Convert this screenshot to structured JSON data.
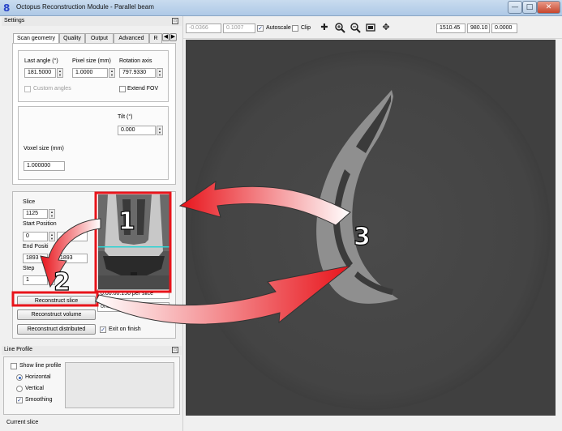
{
  "window": {
    "title": "Octopus Reconstruction Module - Parallel beam",
    "icon": "8"
  },
  "settings": {
    "title": "Settings",
    "tabs": [
      "Scan geometry",
      "Quality",
      "Output",
      "Advanced",
      "R"
    ],
    "last_angle_label": "Last angle (°)",
    "last_angle_value": "181.5000",
    "pixel_size_label": "Pixel size (mm)",
    "pixel_size_value": "1.0000",
    "rotation_axis_label": "Rotation axis",
    "rotation_axis_value": "797.9330",
    "custom_angles_label": "Custom angles",
    "extend_fov_label": "Extend FOV",
    "tilt_label": "Tilt (°)",
    "tilt_value": "0.000",
    "voxel_size_label": "Voxel size (mm)",
    "voxel_size_value": "1.000000"
  },
  "slice": {
    "slice_label": "Slice",
    "slice_value": "1125",
    "start_label": "Start Position",
    "start_value": "0",
    "end_label": "End Positi",
    "end_value_1": "1893",
    "end_value_2": "1893",
    "step_label": "Step",
    "step_value": "1",
    "time_per_slice": "0:00:00.156 per slice",
    "partial_field_label": "ontal",
    "exit_on_finish_label": "Exit on finish"
  },
  "buttons": {
    "reconstruct_slice": "Reconstruct slice",
    "reconstruct_volume": "Reconstruct volume",
    "reconstruct_distributed": "Reconstruct distributed"
  },
  "line_profile": {
    "title": "Line Profile",
    "show_label": "Show line profile",
    "horizontal_label": "Horizontal",
    "vertical_label": "Vertical",
    "smoothing_label": "Smoothing",
    "selected": "Horizontal"
  },
  "toolbar": {
    "min_value": "-0.0366",
    "max_value": "0.1007",
    "autoscale_label": "Autoscale",
    "clip_label": "Clip",
    "coord_x": "1510.45",
    "coord_y": "980.10",
    "pixel_value": "0.0000",
    "tools": [
      "crosshair-icon",
      "zoom-in-icon",
      "zoom-out-icon",
      "fit-window-icon",
      "pan-icon"
    ]
  },
  "status": {
    "text": "Current slice"
  },
  "annotations": {
    "marker_1": "1",
    "marker_2": "2",
    "marker_3": "3"
  },
  "colors": {
    "annotation_red": "#e8141b",
    "viewer_bg": "#404040",
    "titlebar": "#b9d1ea"
  }
}
